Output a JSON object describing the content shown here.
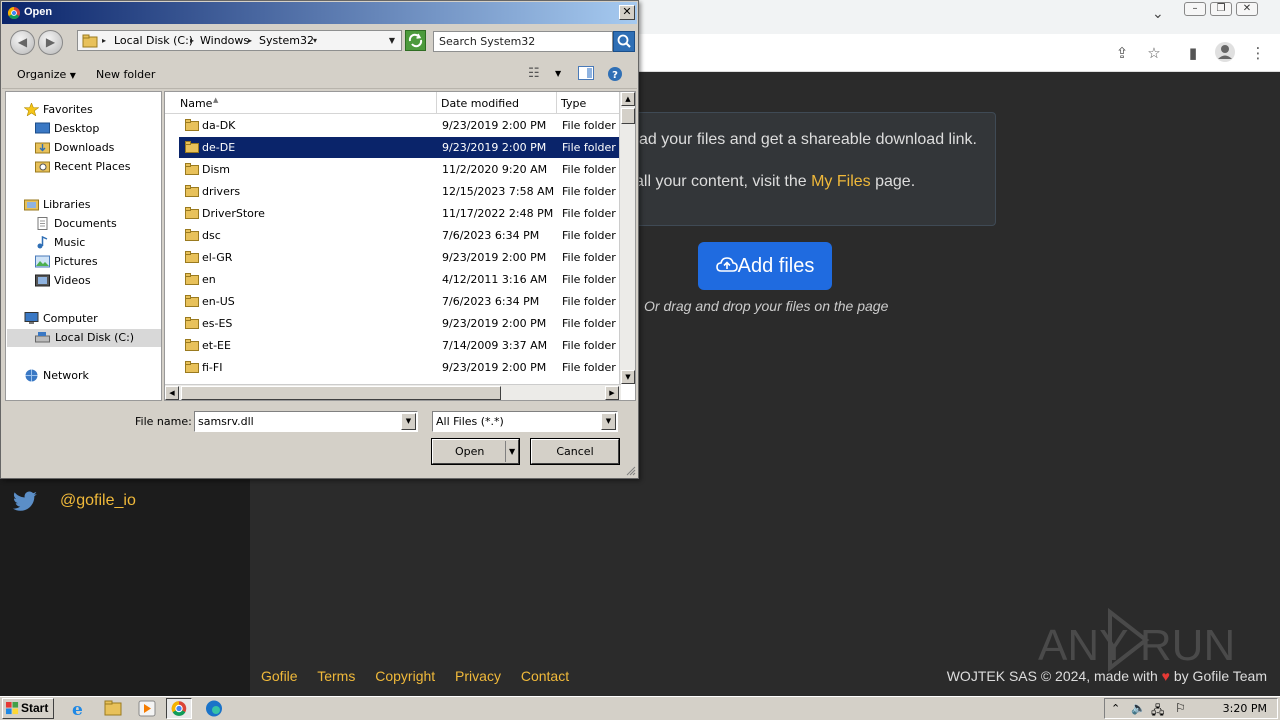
{
  "browser": {
    "colors": {
      "accent": "#f0b93a",
      "button": "#1f6be0",
      "background": "#2b2b2b"
    }
  },
  "page": {
    "info_line1": "ad your files and get a shareable download link.",
    "info_line2_prefix": "all your content, visit the ",
    "info_line2_link": "My Files",
    "info_line2_suffix": " page.",
    "add_files_label": "Add files",
    "drag_hint": "Or drag and drop your files on the page",
    "twitter_handle": "@gofile_io",
    "footer_links": [
      "Gofile",
      "Terms",
      "Copyright",
      "Privacy",
      "Contact"
    ],
    "footer_right_prefix": "WOJTEK SAS © 2024, made with ",
    "footer_right_suffix": " by Gofile Team",
    "watermark": "ANY RUN"
  },
  "dialog": {
    "title": "Open",
    "close_glyph": "✕",
    "breadcrumb": [
      "Local Disk (C:)",
      "Windows",
      "System32"
    ],
    "search_placeholder": "Search System32",
    "organize_label": "Organize",
    "new_folder_label": "New folder",
    "nav": {
      "favorites": "Favorites",
      "desktop": "Desktop",
      "downloads": "Downloads",
      "recent_places": "Recent Places",
      "libraries": "Libraries",
      "documents": "Documents",
      "music": "Music",
      "pictures": "Pictures",
      "videos": "Videos",
      "computer": "Computer",
      "local_disk": "Local Disk (C:)",
      "network": "Network"
    },
    "columns": {
      "name": "Name",
      "date": "Date modified",
      "type": "Type"
    },
    "files": [
      {
        "name": "da-DK",
        "date": "9/23/2019 2:00 PM",
        "type": "File folder"
      },
      {
        "name": "de-DE",
        "date": "9/23/2019 2:00 PM",
        "type": "File folder",
        "selected": true
      },
      {
        "name": "Dism",
        "date": "11/2/2020 9:20 AM",
        "type": "File folder"
      },
      {
        "name": "drivers",
        "date": "12/15/2023 7:58 AM",
        "type": "File folder"
      },
      {
        "name": "DriverStore",
        "date": "11/17/2022 2:48 PM",
        "type": "File folder"
      },
      {
        "name": "dsc",
        "date": "7/6/2023 6:34 PM",
        "type": "File folder"
      },
      {
        "name": "el-GR",
        "date": "9/23/2019 2:00 PM",
        "type": "File folder"
      },
      {
        "name": "en",
        "date": "4/12/2011 3:16 AM",
        "type": "File folder"
      },
      {
        "name": "en-US",
        "date": "7/6/2023 6:34 PM",
        "type": "File folder"
      },
      {
        "name": "es-ES",
        "date": "9/23/2019 2:00 PM",
        "type": "File folder"
      },
      {
        "name": "et-EE",
        "date": "7/14/2009 3:37 AM",
        "type": "File folder"
      },
      {
        "name": "fi-FI",
        "date": "9/23/2019 2:00 PM",
        "type": "File folder"
      }
    ],
    "file_name_label": "File name:",
    "file_name_value": "samsrv.dll",
    "filter_value": "All Files (*.*)",
    "open_label": "Open",
    "cancel_label": "Cancel"
  },
  "taskbar": {
    "start_label": "Start",
    "clock": "3:20 PM"
  }
}
